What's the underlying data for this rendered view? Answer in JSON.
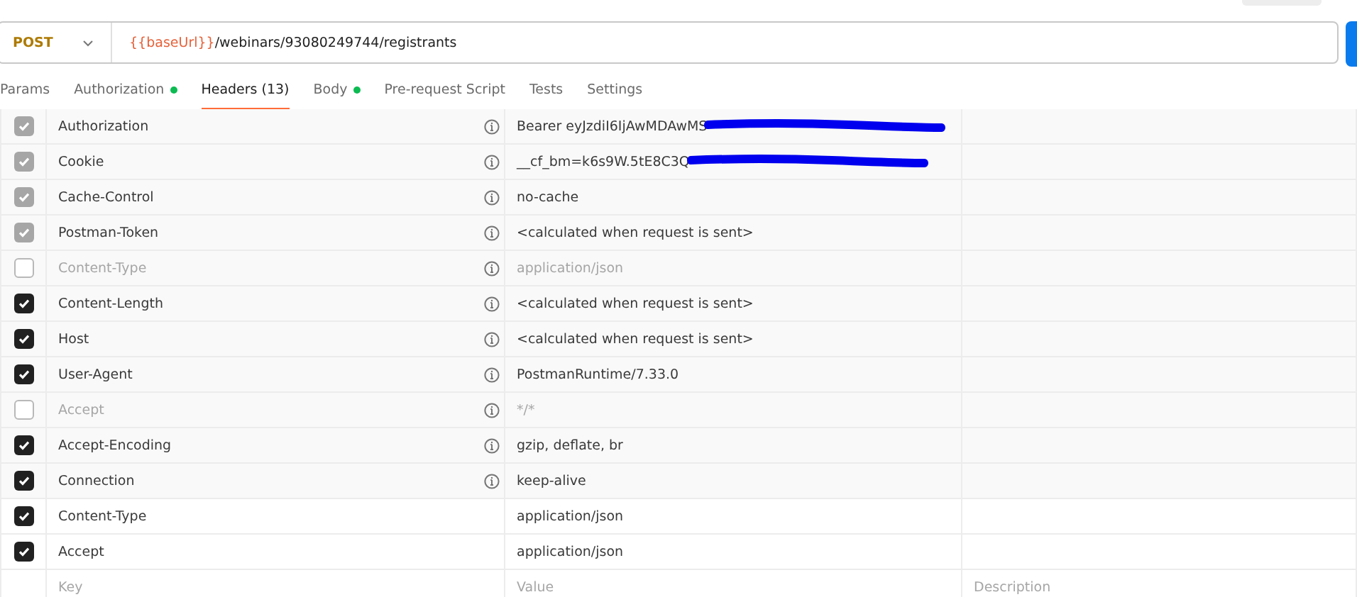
{
  "request": {
    "method": "POST",
    "url_variable": "{{baseUrl}}",
    "url_path": "/webinars/93080249744/registrants"
  },
  "tabs": [
    {
      "label": "Params",
      "selected": false,
      "dot": false
    },
    {
      "label": "Authorization",
      "selected": false,
      "dot": true
    },
    {
      "label": "Headers (13)",
      "selected": true,
      "dot": false
    },
    {
      "label": "Body",
      "selected": false,
      "dot": true
    },
    {
      "label": "Pre-request Script",
      "selected": false,
      "dot": false
    },
    {
      "label": "Tests",
      "selected": false,
      "dot": false
    },
    {
      "label": "Settings",
      "selected": false,
      "dot": false
    }
  ],
  "headers": [
    {
      "kind": "auto",
      "checked": true,
      "locked": true,
      "key": "Authorization",
      "value": "Bearer eyJzdiI6IjAwMDAwMS",
      "redacted": true
    },
    {
      "kind": "auto",
      "checked": true,
      "locked": true,
      "key": "Cookie",
      "value": "__cf_bm=k6s9W.5tE8C3Q",
      "redacted": true
    },
    {
      "kind": "auto",
      "checked": true,
      "locked": true,
      "key": "Cache-Control",
      "value": "no-cache"
    },
    {
      "kind": "auto",
      "checked": true,
      "locked": true,
      "key": "Postman-Token",
      "value": "<calculated when request is sent>"
    },
    {
      "kind": "auto",
      "checked": false,
      "key": "Content-Type",
      "value": "application/json"
    },
    {
      "kind": "auto",
      "checked": true,
      "key": "Content-Length",
      "value": "<calculated when request is sent>"
    },
    {
      "kind": "auto",
      "checked": true,
      "key": "Host",
      "value": "<calculated when request is sent>"
    },
    {
      "kind": "auto",
      "checked": true,
      "key": "User-Agent",
      "value": "PostmanRuntime/7.33.0"
    },
    {
      "kind": "auto",
      "checked": false,
      "key": "Accept",
      "value": "*/*"
    },
    {
      "kind": "auto",
      "checked": true,
      "key": "Accept-Encoding",
      "value": "gzip, deflate, br"
    },
    {
      "kind": "auto",
      "checked": true,
      "key": "Connection",
      "value": "keep-alive"
    },
    {
      "kind": "user",
      "checked": true,
      "key": "Content-Type",
      "value": "application/json"
    },
    {
      "kind": "user",
      "checked": true,
      "key": "Accept",
      "value": "application/json"
    }
  ],
  "new_row": {
    "key_placeholder": "Key",
    "value_placeholder": "Value",
    "description_placeholder": "Description"
  }
}
